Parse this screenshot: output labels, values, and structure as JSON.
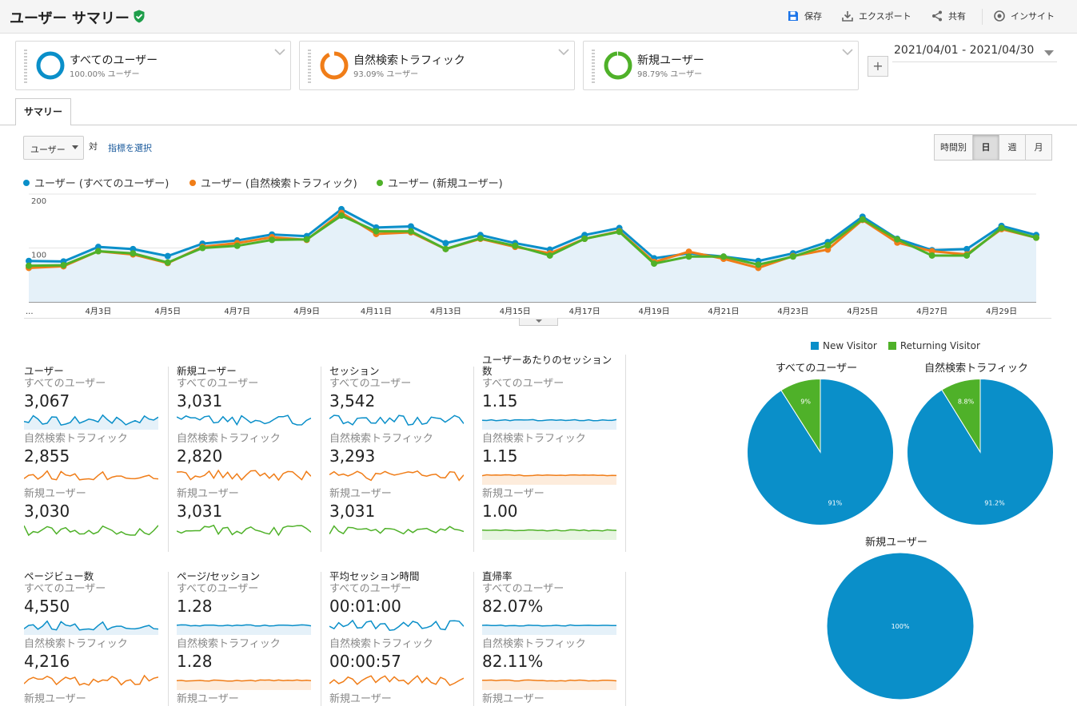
{
  "header": {
    "title": "ユーザー サマリー",
    "tools": {
      "save": "保存",
      "export": "エクスポート",
      "share": "共有",
      "insights": "インサイト"
    }
  },
  "segments": [
    {
      "name": "すべてのユーザー",
      "pct": "100.00% ユーザー",
      "color": "#0a8fc9"
    },
    {
      "name": "自然検索トラフィック",
      "pct": "93.09% ユーザー",
      "color": "#f07d18"
    },
    {
      "name": "新規ユーザー",
      "pct": "98.79% ユーザー",
      "color": "#4fb129"
    }
  ],
  "add_segment": "+",
  "date_range": "2021/04/01 - 2021/04/30",
  "tabs": {
    "summary": "サマリー"
  },
  "controls": {
    "metric": "ユーザー",
    "vs": "対",
    "select_metric": "指標を選択",
    "periods": [
      "時間別",
      "日",
      "週",
      "月"
    ],
    "active_period": "日"
  },
  "legend": [
    {
      "label": "ユーザー (すべてのユーザー)",
      "color": "#0a8fc9"
    },
    {
      "label": "ユーザー (自然検索トラフィック)",
      "color": "#f07d18"
    },
    {
      "label": "ユーザー (新規ユーザー)",
      "color": "#4fb129"
    }
  ],
  "chart_data": [
    {
      "type": "line",
      "ylim": [
        0,
        200
      ],
      "yticks": [
        "200",
        "100"
      ],
      "x": [
        "4/1",
        "4/2",
        "4/3",
        "4/4",
        "4/5",
        "4/6",
        "4/7",
        "4/8",
        "4/9",
        "4/10",
        "4/11",
        "4/12",
        "4/13",
        "4/14",
        "4/15",
        "4/16",
        "4/17",
        "4/18",
        "4/19",
        "4/20",
        "4/21",
        "4/22",
        "4/23",
        "4/24",
        "4/25",
        "4/26",
        "4/27",
        "4/28",
        "4/29",
        "4/30"
      ],
      "xticks": [
        "...",
        "4月3日",
        "4月5日",
        "4月7日",
        "4月9日",
        "4月11日",
        "4月13日",
        "4月15日",
        "4月17日",
        "4月19日",
        "4月21日",
        "4月23日",
        "4月25日",
        "4月27日",
        "4月29日"
      ],
      "series": [
        {
          "name": "ユーザー (すべてのユーザー)",
          "color": "#0a8fc9",
          "values": [
            76,
            75,
            102,
            98,
            85,
            108,
            114,
            125,
            122,
            172,
            138,
            140,
            109,
            124,
            109,
            97,
            124,
            137,
            81,
            90,
            84,
            76,
            90,
            111,
            158,
            117,
            96,
            98,
            141,
            124
          ]
        },
        {
          "name": "ユーザー (自然検索トラフィック)",
          "color": "#f07d18",
          "values": [
            63,
            66,
            94,
            88,
            72,
            102,
            109,
            120,
            115,
            165,
            126,
            129,
            98,
            117,
            102,
            90,
            117,
            131,
            74,
            93,
            80,
            63,
            85,
            97,
            152,
            110,
            94,
            88,
            135,
            119
          ]
        },
        {
          "name": "ユーザー (新規ユーザー)",
          "color": "#4fb129",
          "values": [
            67,
            68,
            94,
            90,
            73,
            100,
            104,
            115,
            116,
            160,
            131,
            131,
            98,
            118,
            104,
            86,
            117,
            130,
            71,
            84,
            84,
            69,
            84,
            105,
            153,
            116,
            86,
            86,
            137,
            119
          ]
        }
      ]
    },
    {
      "type": "pie",
      "title": "すべてのユーザー",
      "slices": [
        {
          "label": "New Visitor",
          "value": 91,
          "text": "91%"
        },
        {
          "label": "Returning Visitor",
          "value": 9,
          "text": "9%"
        }
      ]
    },
    {
      "type": "pie",
      "title": "自然検索トラフィック",
      "slices": [
        {
          "label": "New Visitor",
          "value": 91.2,
          "text": "91.2%"
        },
        {
          "label": "Returning Visitor",
          "value": 8.8,
          "text": "8.8%"
        }
      ]
    },
    {
      "type": "pie",
      "title": "新規ユーザー",
      "slices": [
        {
          "label": "New Visitor",
          "value": 100,
          "text": "100%"
        }
      ]
    }
  ],
  "pie_legend": {
    "new": "New Visitor",
    "returning": "Returning Visitor",
    "new_color": "#0a8fc9",
    "returning_color": "#4fb129"
  },
  "tiles_row1": [
    {
      "title": "ユーザー",
      "seg1": "すべてのユーザー",
      "v1": "3,067",
      "seg2": "自然検索トラフィック",
      "v2": "2,855",
      "seg3": "新規ユーザー",
      "v3": "3,030"
    },
    {
      "title": "新規ユーザー",
      "seg1": "すべてのユーザー",
      "v1": "3,031",
      "seg2": "自然検索トラフィック",
      "v2": "2,820",
      "seg3": "新規ユーザー",
      "v3": "3,031"
    },
    {
      "title": "セッション",
      "seg1": "すべてのユーザー",
      "v1": "3,542",
      "seg2": "自然検索トラフィック",
      "v2": "3,293",
      "seg3": "新規ユーザー",
      "v3": "3,031"
    },
    {
      "title": "ユーザーあたりのセッション数",
      "seg1": "すべてのユーザー",
      "v1": "1.15",
      "seg2": "自然検索トラフィック",
      "v2": "1.15",
      "seg3": "新規ユーザー",
      "v3": "1.00"
    }
  ],
  "tiles_row2": [
    {
      "title": "ページビュー数",
      "seg1": "すべてのユーザー",
      "v1": "4,550",
      "seg2": "自然検索トラフィック",
      "v2": "4,216",
      "seg3": "新規ユーザー"
    },
    {
      "title": "ページ/セッション",
      "seg1": "すべてのユーザー",
      "v1": "1.28",
      "seg2": "自然検索トラフィック",
      "v2": "1.28",
      "seg3": "新規ユーザー"
    },
    {
      "title": "平均セッション時間",
      "seg1": "すべてのユーザー",
      "v1": "00:01:00",
      "seg2": "自然検索トラフィック",
      "v2": "00:00:57",
      "seg3": "新規ユーザー"
    },
    {
      "title": "直帰率",
      "seg1": "すべてのユーザー",
      "v1": "82.07%",
      "seg2": "自然検索トラフィック",
      "v2": "82.11%",
      "seg3": "新規ユーザー"
    }
  ]
}
